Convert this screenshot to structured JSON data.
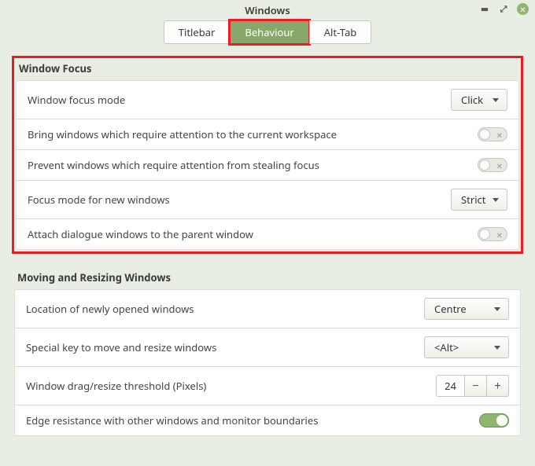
{
  "title": "Windows",
  "tabs": {
    "titlebar": "Titlebar",
    "behaviour": "Behaviour",
    "alttab": "Alt-Tab"
  },
  "focus": {
    "heading": "Window Focus",
    "mode_label": "Window focus mode",
    "mode_value": "Click",
    "bring_label": "Bring windows which require attention to the current workspace",
    "prevent_label": "Prevent windows which require attention from stealing focus",
    "newmode_label": "Focus mode for new windows",
    "newmode_value": "Strict",
    "attach_label": "Attach dialogue windows to the parent window"
  },
  "move": {
    "heading": "Moving and Resizing Windows",
    "location_label": "Location of newly opened windows",
    "location_value": "Centre",
    "key_label": "Special key to move and resize windows",
    "key_value": "<Alt>",
    "threshold_label": "Window drag/resize threshold (Pixels)",
    "threshold_value": "24",
    "edge_label": "Edge resistance with other windows and monitor boundaries"
  }
}
